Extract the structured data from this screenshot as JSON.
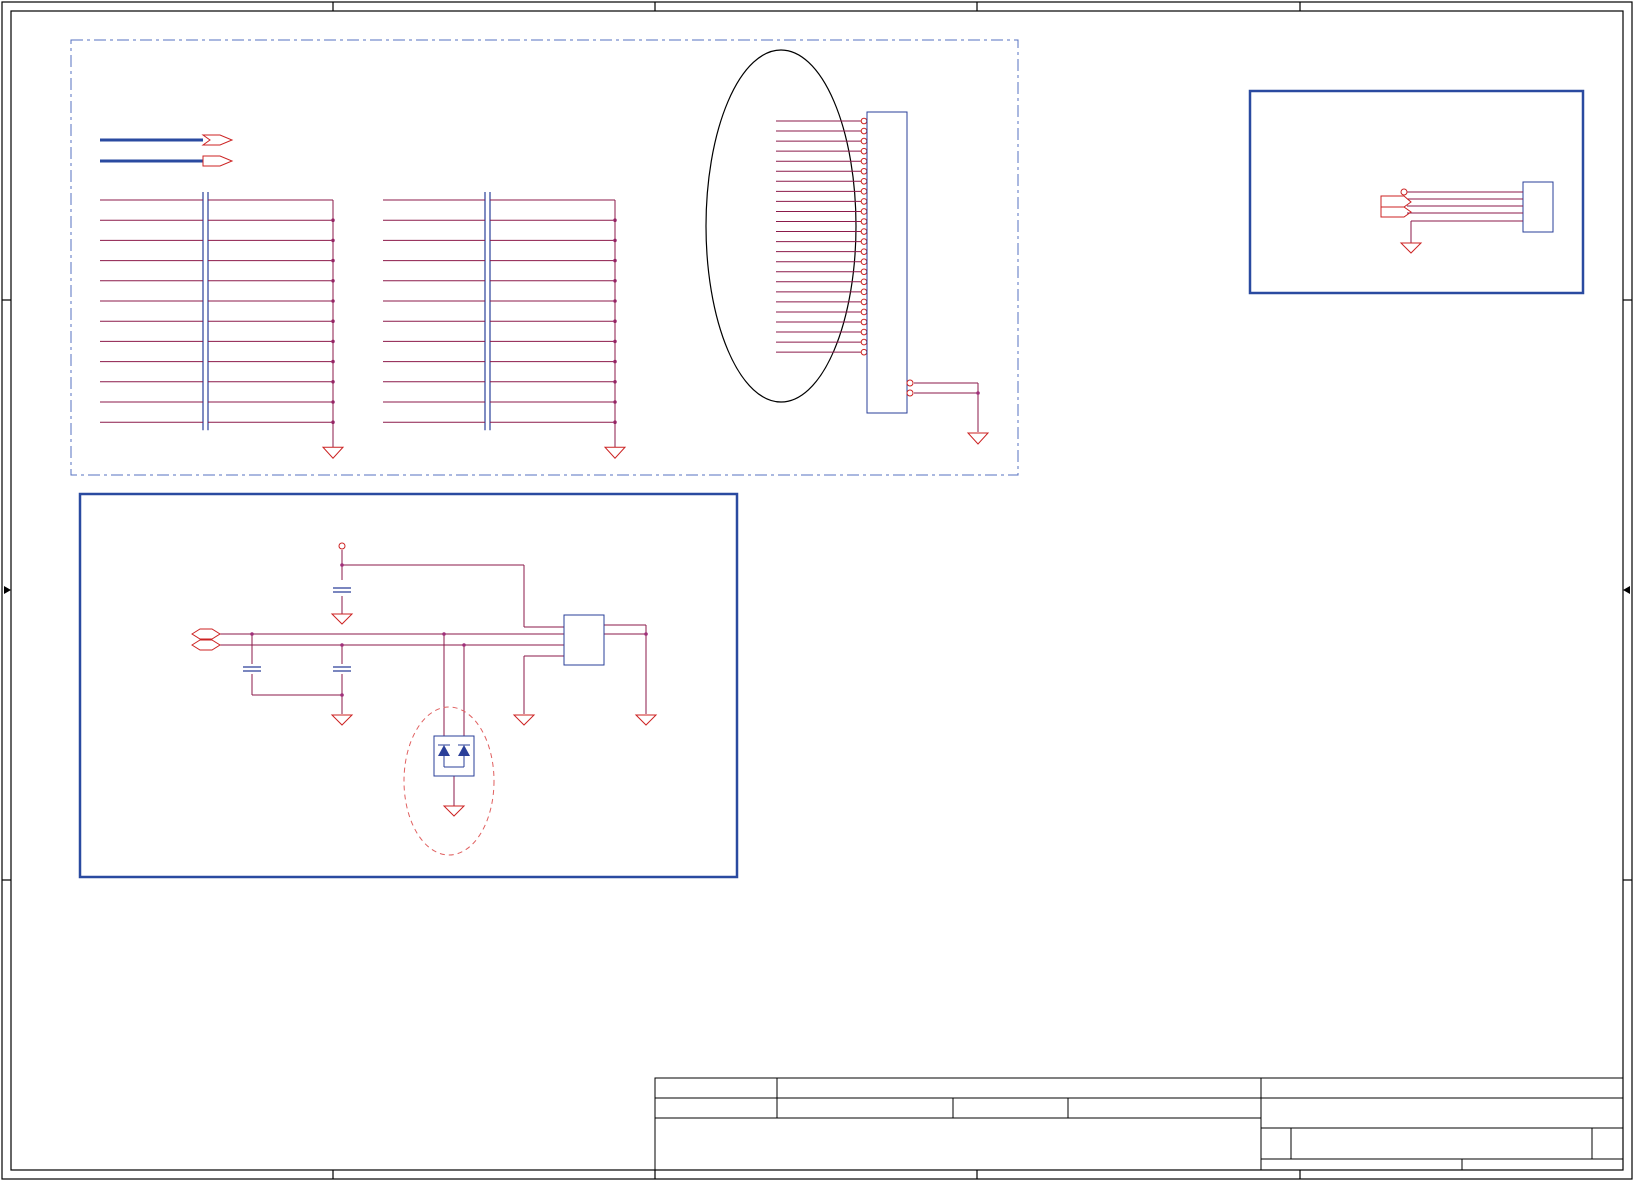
{
  "sheet": {
    "zone_columns": 5,
    "zone_rows": 4,
    "title_block_text": []
  },
  "colors": {
    "frame": "#000000",
    "wire": "#cc2222",
    "net": "#8b1a4a",
    "component": "#2a3f99",
    "junction": "#a0307a",
    "border_box": "#2a4aa0",
    "dashed_region": "#5570c0"
  },
  "blocks": {
    "dashed_region": {
      "name": "connector-region",
      "bus_groups": 2,
      "lines_per_bus": 12,
      "connector_pins": 24
    },
    "top_right_block": {
      "name": "small-connector-block",
      "pins": 4
    },
    "bottom_left_block": {
      "name": "power-filter-block",
      "capacitors": 3,
      "diodes": 2
    }
  }
}
